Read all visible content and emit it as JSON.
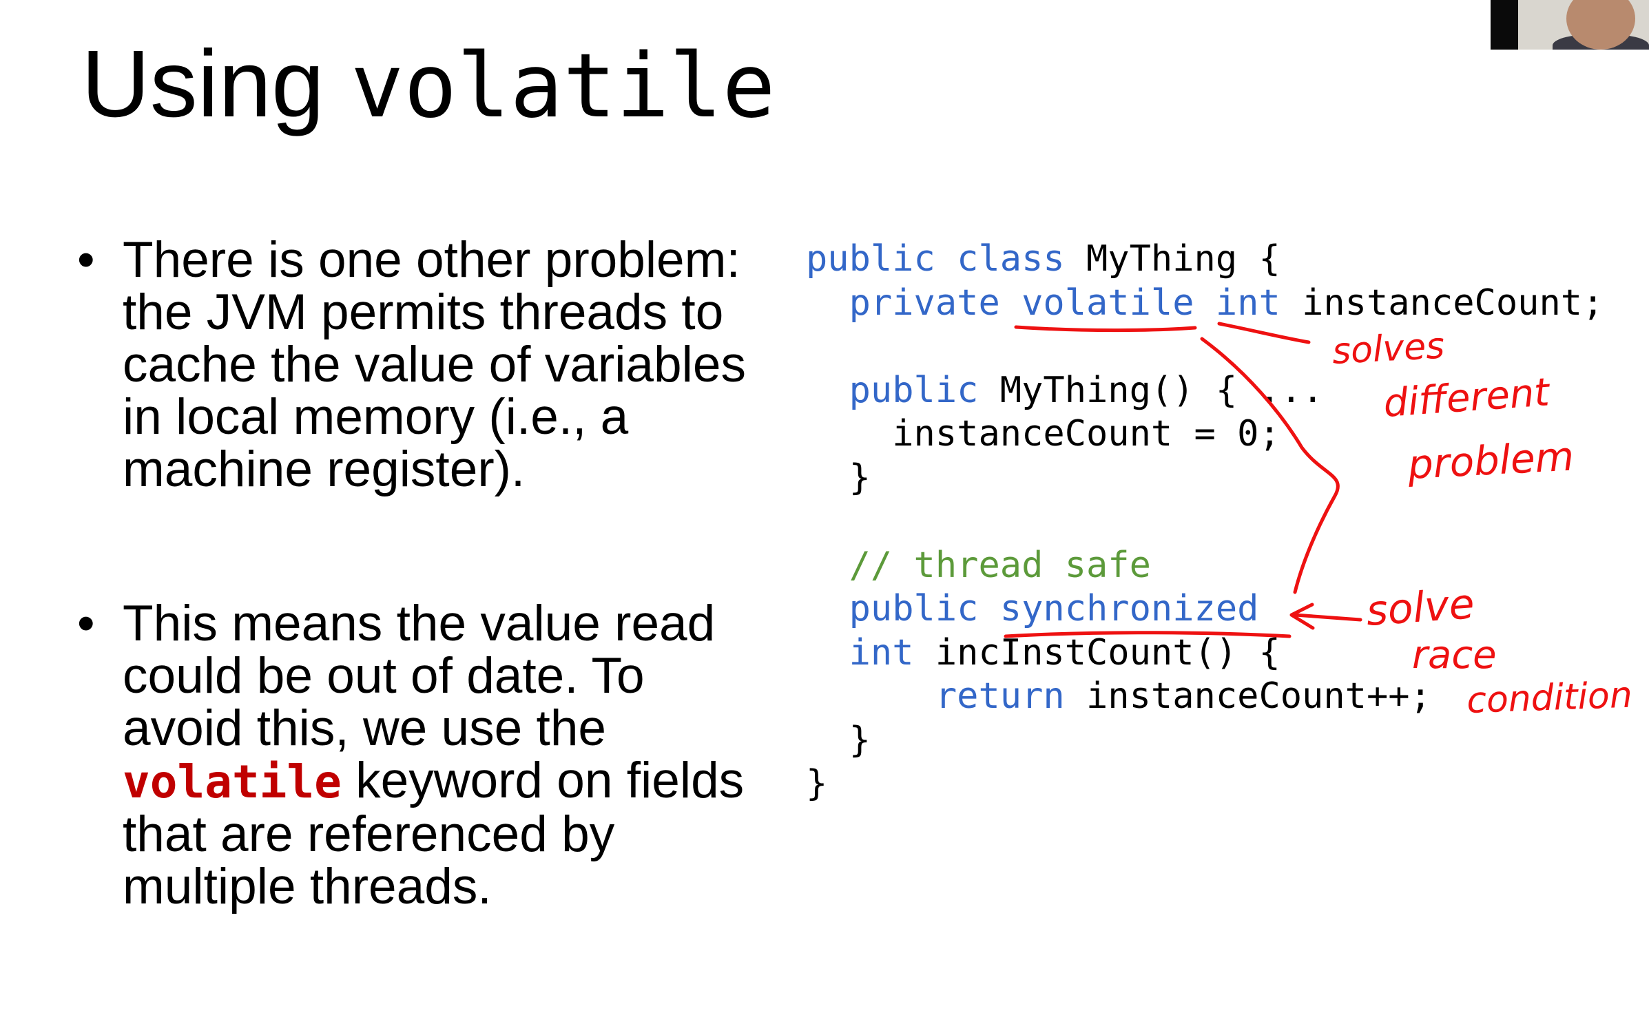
{
  "title": {
    "plain": "Using ",
    "code": "volatile"
  },
  "bullets": {
    "b1": "There is one other problem:  the JVM permits threads to cache the value of variables in local memory (i.e., a machine register).",
    "b2_before": "This means the value read could be out of date. To avoid this, we use the ",
    "b2_keyword": "volatile",
    "b2_after": " keyword on fields that are referenced by multiple threads."
  },
  "code": {
    "l1_kw": "public class",
    "l1_rest": " MyThing {",
    "l2_kw": "private volatile int",
    "l2_rest": " instanceCount;",
    "l4_kw": "public",
    "l4_rest": " MyThing() { ...",
    "l5": "instanceCount = 0;",
    "l6": "}",
    "l8_comment": "// thread safe",
    "l9_kw": "public synchronized",
    "l10_kw": "int",
    "l10_rest": " incInstCount() {",
    "l11_kw": "return",
    "l11_rest": " instanceCount++;",
    "l12": "}",
    "l13": "}"
  },
  "annotations": {
    "note1": [
      "solves",
      "different",
      "problem"
    ],
    "note2": [
      "solve",
      "race",
      "condition"
    ]
  },
  "colors": {
    "keyword": "#3367c8",
    "comment": "#5c9a3a",
    "highlight": "#c00000",
    "ink": "#ee1111"
  },
  "webcam": {
    "icon": "webcam-thumbnail"
  }
}
